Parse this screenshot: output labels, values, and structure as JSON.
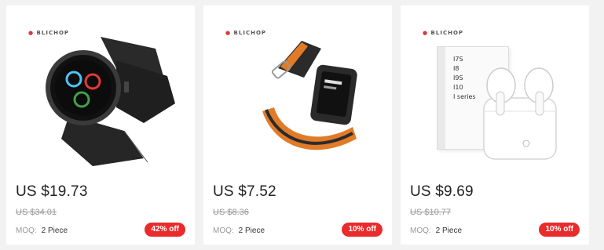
{
  "products": [
    {
      "brand": "BLICHOP",
      "image_alt": "Black smartwatch with leather strap",
      "price": "US $19.73",
      "old_price": "US $34.01",
      "moq_label": "MOQ:",
      "moq_value": "2 Piece",
      "discount": "42% off"
    },
    {
      "brand": "BLICHOP",
      "image_alt": "Fitness smartwatch with orange and black strap",
      "price": "US $7.52",
      "old_price": "US $8.36",
      "moq_label": "MOQ:",
      "moq_value": "2 Piece",
      "discount": "10% off"
    },
    {
      "brand": "BLICHOP",
      "image_alt": "White wireless earbuds with charging case",
      "box_lines": [
        "I7S",
        "I8",
        "I9S",
        "I10",
        "I series"
      ],
      "price": "US $9.69",
      "old_price": "US $10.77",
      "moq_label": "MOQ:",
      "moq_value": "2 Piece",
      "discount": "10% off"
    }
  ],
  "colors": {
    "badge": "#ea2b2b",
    "orange_strap": "#e07b28",
    "background": "#f2f2f2"
  }
}
